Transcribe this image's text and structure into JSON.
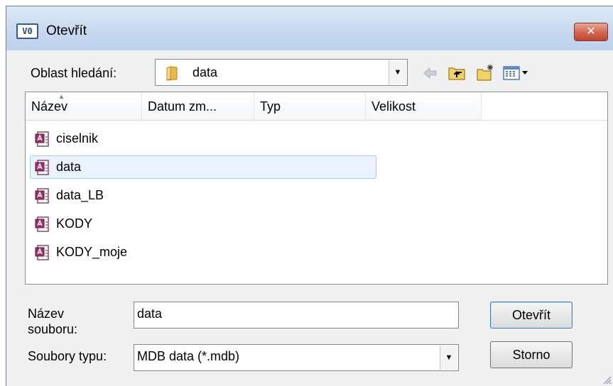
{
  "dialog": {
    "title": "Otevřít",
    "app_icon_text": "V0",
    "close_glyph": "✕"
  },
  "look_in": {
    "label": "Oblast hledání:",
    "value": "data",
    "icon": "folder-icon"
  },
  "toolbar": {
    "icons": [
      "back-arrow-icon",
      "up-folder-icon",
      "new-folder-icon",
      "view-menu-icon"
    ]
  },
  "file_list": {
    "columns": [
      "Název",
      "Datum zm...",
      "Typ",
      "Velikost"
    ],
    "sorted_column": "Název",
    "items": [
      {
        "name": "ciselnik",
        "icon": "access-database-icon",
        "selected": false
      },
      {
        "name": "data",
        "icon": "access-database-icon",
        "selected": true
      },
      {
        "name": "data_LB",
        "icon": "access-database-icon",
        "selected": false
      },
      {
        "name": "KODY",
        "icon": "access-database-icon",
        "selected": false
      },
      {
        "name": "KODY_moje",
        "icon": "access-database-icon",
        "selected": false
      }
    ]
  },
  "filename": {
    "label_line1": "Název",
    "label_line2": "souboru:",
    "value": "data"
  },
  "filetype": {
    "label": "Soubory typu:",
    "value": "MDB data (*.mdb)"
  },
  "buttons": {
    "open": "Otevřít",
    "cancel": "Storno"
  },
  "colors": {
    "selection_bg": "#eaf3fd",
    "selection_border": "#a8cbee",
    "close_button": "#c2442c",
    "folder": "#e8b84a"
  }
}
